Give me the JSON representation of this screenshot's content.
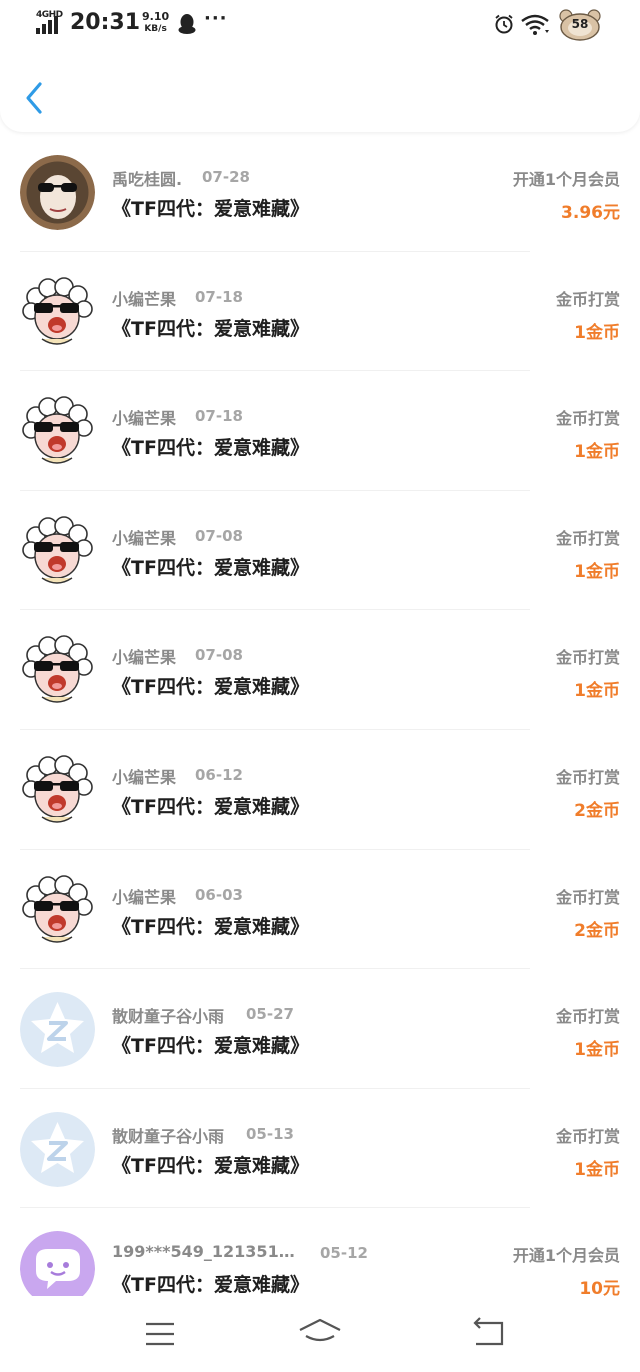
{
  "status": {
    "network": "4GHD",
    "time": "20:31",
    "speed_value": "9.10",
    "speed_unit": "KB/s",
    "more": "···",
    "battery": "58"
  },
  "colors": {
    "amount": "#f07d2b",
    "back_arrow": "#2f9be6",
    "secondary_text": "#8a8a8a"
  },
  "records": [
    {
      "avatar": "photo-avatar",
      "name": "禹吃桂圆.",
      "date": "07-28",
      "title": "《TF四代：爱意难藏》",
      "type": "开通1个月会员",
      "amount": "3.96元"
    },
    {
      "avatar": "sheep-avatar",
      "name": "小编芒果",
      "date": "07-18",
      "title": "《TF四代：爱意难藏》",
      "type": "金币打赏",
      "amount": "1金币"
    },
    {
      "avatar": "sheep-avatar",
      "name": "小编芒果",
      "date": "07-18",
      "title": "《TF四代：爱意难藏》",
      "type": "金币打赏",
      "amount": "1金币"
    },
    {
      "avatar": "sheep-avatar",
      "name": "小编芒果",
      "date": "07-08",
      "title": "《TF四代：爱意难藏》",
      "type": "金币打赏",
      "amount": "1金币"
    },
    {
      "avatar": "sheep-avatar",
      "name": "小编芒果",
      "date": "07-08",
      "title": "《TF四代：爱意难藏》",
      "type": "金币打赏",
      "amount": "1金币"
    },
    {
      "avatar": "sheep-avatar",
      "name": "小编芒果",
      "date": "06-12",
      "title": "《TF四代：爱意难藏》",
      "type": "金币打赏",
      "amount": "2金币"
    },
    {
      "avatar": "sheep-avatar",
      "name": "小编芒果",
      "date": "06-03",
      "title": "《TF四代：爱意难藏》",
      "type": "金币打赏",
      "amount": "2金币"
    },
    {
      "avatar": "default-z-avatar",
      "name": "散财童子谷小雨",
      "date": "05-27",
      "title": "《TF四代：爱意难藏》",
      "type": "金币打赏",
      "amount": "1金币"
    },
    {
      "avatar": "default-z-avatar",
      "name": "散财童子谷小雨",
      "date": "05-13",
      "title": "《TF四代：爱意难藏》",
      "type": "金币打赏",
      "amount": "1金币"
    },
    {
      "avatar": "chat-bubble-avatar",
      "name": "199***549_121351…",
      "date": "05-12",
      "title": "《TF四代：爱意难藏》",
      "type": "开通1个月会员",
      "amount": "10元"
    }
  ],
  "icons": {
    "back": "chevron-left-icon",
    "nav_menu": "menu-icon",
    "nav_home": "home-icon",
    "nav_back": "return-icon"
  }
}
